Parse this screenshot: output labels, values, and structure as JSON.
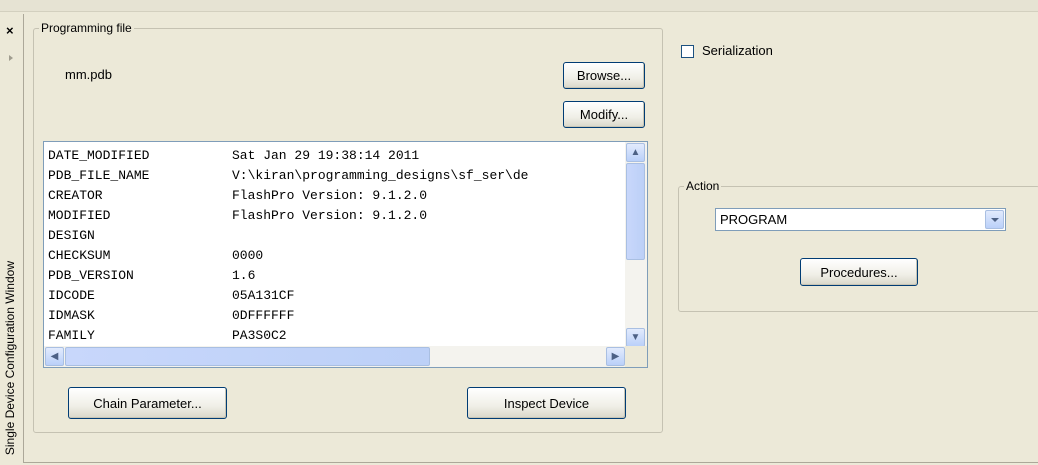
{
  "panel": {
    "close_glyph": "×",
    "vertical_title": "Single Device Configuration Window"
  },
  "programming_file": {
    "legend": "Programming file",
    "filename": "mm.pdb",
    "browse_label": "Browse...",
    "modify_label": "Modify...",
    "properties": [
      {
        "key": "DATE_MODIFIED",
        "value": "Sat Jan 29 19:38:14 2011"
      },
      {
        "key": "PDB_FILE_NAME",
        "value": "V:\\kiran\\programming_designs\\sf_ser\\de"
      },
      {
        "key": "CREATOR",
        "value": "FlashPro Version: 9.1.2.0"
      },
      {
        "key": "MODIFIED",
        "value": "FlashPro Version: 9.1.2.0"
      },
      {
        "key": "DESIGN",
        "value": ""
      },
      {
        "key": "CHECKSUM",
        "value": "0000"
      },
      {
        "key": "PDB_VERSION",
        "value": "1.6"
      },
      {
        "key": "IDCODE",
        "value": "05A131CF"
      },
      {
        "key": "IDMASK",
        "value": "0DFFFFFF"
      },
      {
        "key": "FAMILY",
        "value": "PA3S0C2"
      }
    ],
    "chain_parameter_label": "Chain Parameter...",
    "inspect_device_label": "Inspect Device"
  },
  "serialization": {
    "label": "Serialization",
    "checked": false
  },
  "action": {
    "legend": "Action",
    "selected": "PROGRAM",
    "procedures_label": "Procedures..."
  }
}
